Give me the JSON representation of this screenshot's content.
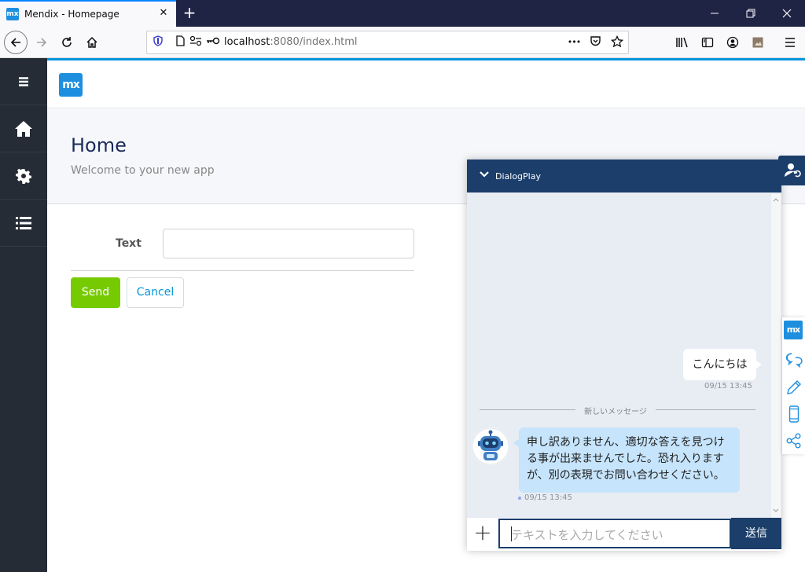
{
  "browser": {
    "tab_title": "Mendix - Homepage",
    "tab_favicon": "mx",
    "close_glyph": "✕",
    "new_tab_glyph": "+",
    "url_host": "localhost",
    "url_rest": ":8080/index.html",
    "page_actions_glyph": "•••",
    "icons": [
      "back-arrow-icon",
      "forward-arrow-icon",
      "reload-icon",
      "home-icon",
      "shield-icon",
      "page-icon",
      "permissions-icon",
      "key-icon",
      "more-icon",
      "pocket-icon",
      "bookmark-star-icon",
      "library-icon",
      "sidebar-icon",
      "account-icon",
      "extension-icon",
      "menu-icon"
    ]
  },
  "app": {
    "logo": "mx",
    "page_title": "Home",
    "page_subtitle": "Welcome to your new app",
    "form": {
      "text_label": "Text",
      "text_value": "",
      "send_label": "Send",
      "cancel_label": "Cancel"
    },
    "sidebar_icons": [
      "hamburger-icon",
      "home-icon",
      "gear-icon",
      "list-icon"
    ]
  },
  "chat": {
    "title": "DialogPlay",
    "user_message": "こんにちは",
    "user_time": "09/15 13:45",
    "separator_label": "新しいメッセージ",
    "bot_message": "申し訳ありません、適切な答えを見つける事が出来ませんでした。恐れ入りますが、別の表現でお問い合わせください。",
    "bot_time": "09/15 13:45",
    "input_placeholder": "テキストを入力してください",
    "send_label": "送信",
    "plus_glyph": "+",
    "tool_logo": "mx"
  },
  "colors": {
    "brand": "#1e8fdf",
    "send_green": "#76ca02",
    "chat_navy": "#1b3e6b",
    "sidebar": "#252c36",
    "bot_bubble": "#c6e4fb"
  }
}
